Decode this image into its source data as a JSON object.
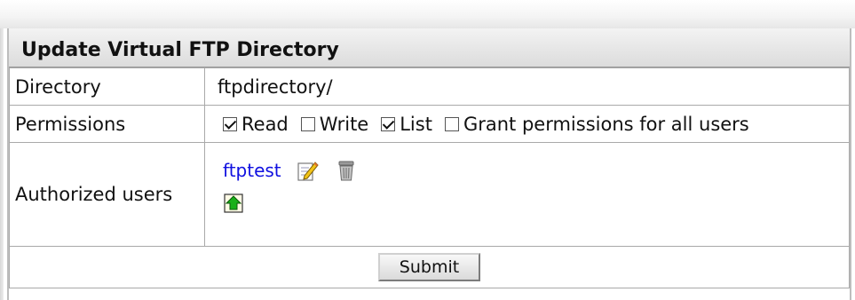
{
  "title": "Update Virtual FTP Directory",
  "directory": {
    "label": "Directory",
    "value": "ftpdirectory/"
  },
  "permissions": {
    "label": "Permissions",
    "options": [
      {
        "label": "Read",
        "checked": true
      },
      {
        "label": "Write",
        "checked": false
      },
      {
        "label": "List",
        "checked": true
      },
      {
        "label": "Grant permissions for all users",
        "checked": false
      }
    ]
  },
  "authorized_users": {
    "label": "Authorized users",
    "users": [
      {
        "name": "ftptest",
        "icons": [
          "edit-icon",
          "trash-icon"
        ]
      }
    ],
    "add_icon": "upload-user-icon"
  },
  "submit_label": "Submit",
  "colors": {
    "link": "#1010e0",
    "title_bg": "#dcdcdc",
    "border": "#a9a9a9"
  }
}
